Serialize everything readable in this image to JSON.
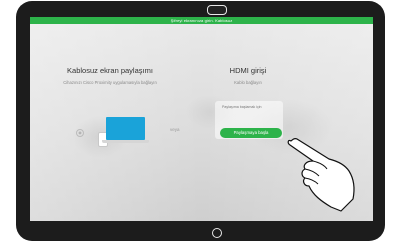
{
  "status_bar": {
    "text": "Şifreyi ekranınıza girin. Kablosuz"
  },
  "wireless": {
    "title": "Kablosuz ekran paylaşımı",
    "description": "Cihazınızı Cisco Proximity uygulamasıyla bağlayın"
  },
  "separator": {
    "text": "veya"
  },
  "hdmi": {
    "title": "HDMI girişi",
    "description": "Kablo bağlayın",
    "hint": "Paylaşıma başlamak için",
    "share_button": "Paylaşmaya başla"
  },
  "icons": {
    "camera": "camera-icon",
    "home": "home-button-icon",
    "proximity": "proximity-icon",
    "laptop": "laptop-icon",
    "phone": "phone-icon",
    "hand": "pointing-hand-icon"
  },
  "colors": {
    "accent": "#2db34a",
    "laptop": "#1aa3d9",
    "frame": "#1c1c1c"
  }
}
